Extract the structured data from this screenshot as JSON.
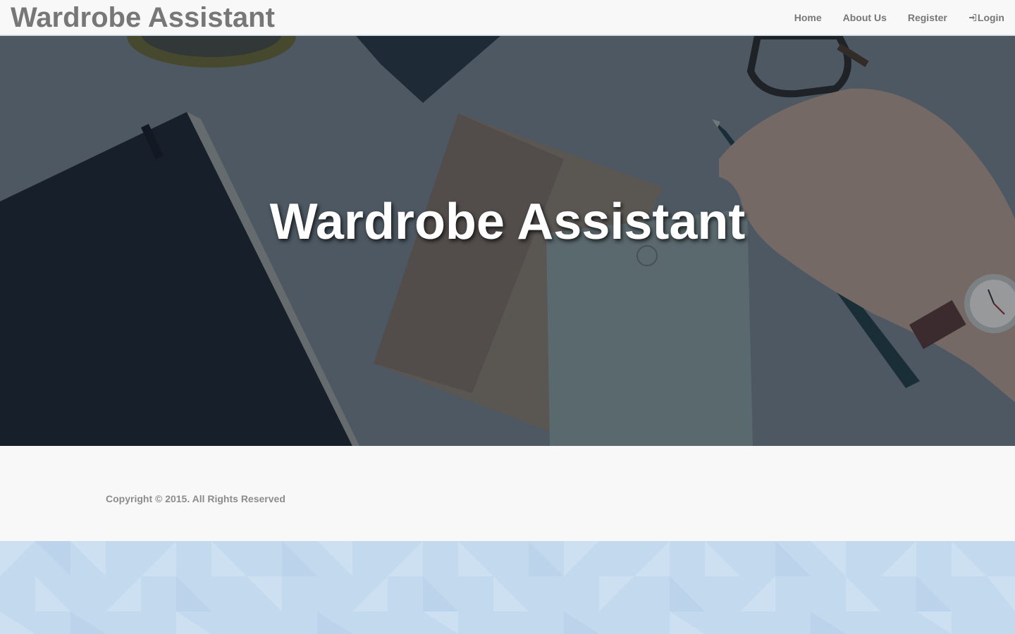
{
  "navbar": {
    "brand": "Wardrobe Assistant",
    "links": [
      {
        "label": "Home"
      },
      {
        "label": "About Us"
      },
      {
        "label": "Register"
      },
      {
        "label": "Login",
        "icon": "login-icon"
      }
    ]
  },
  "hero": {
    "title": "Wardrobe Assistant"
  },
  "footer": {
    "copyright": "Copyright © 2015. All Rights Reserved"
  },
  "colors": {
    "navbar_bg": "#f8f8f8",
    "nav_text": "#777777",
    "hero_overlay": "#5e6770",
    "footer_bg": "#f8f8f8",
    "pattern_bg": "#c3d9ee"
  }
}
